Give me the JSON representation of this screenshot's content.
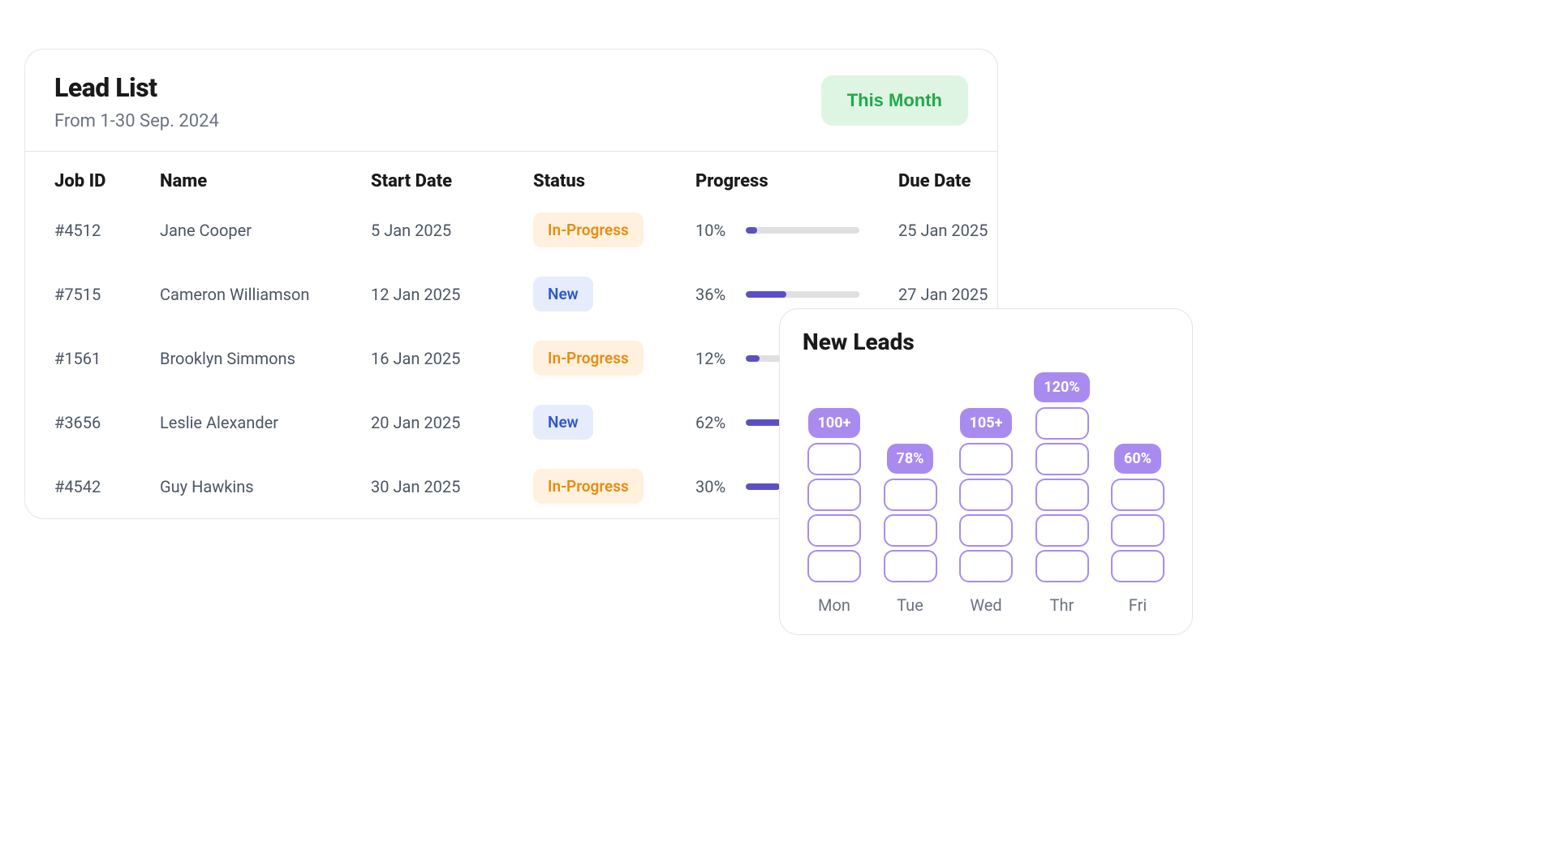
{
  "lead_list": {
    "title": "Lead List",
    "subtitle": "From 1-30 Sep. 2024",
    "period_label": "This Month",
    "columns": {
      "job_id": "Job ID",
      "name": "Name",
      "start_date": "Start Date",
      "status": "Status",
      "progress": "Progress",
      "due_date": "Due Date"
    },
    "rows": [
      {
        "job_id": "#4512",
        "name": "Jane Cooper",
        "start_date": "5 Jan 2025",
        "status": "In-Progress",
        "status_kind": "inprogress",
        "progress": 10,
        "progress_label": "10%",
        "due_date": "25 Jan 2025"
      },
      {
        "job_id": "#7515",
        "name": "Cameron Williamson",
        "start_date": "12 Jan 2025",
        "status": "New",
        "status_kind": "new",
        "progress": 36,
        "progress_label": "36%",
        "due_date": "27 Jan 2025"
      },
      {
        "job_id": "#1561",
        "name": "Brooklyn Simmons",
        "start_date": "16 Jan 2025",
        "status": "In-Progress",
        "status_kind": "inprogress",
        "progress": 12,
        "progress_label": "12%",
        "due_date": ""
      },
      {
        "job_id": "#3656",
        "name": "Leslie Alexander",
        "start_date": "20 Jan 2025",
        "status": "New",
        "status_kind": "new",
        "progress": 62,
        "progress_label": "62%",
        "due_date": ""
      },
      {
        "job_id": "#4542",
        "name": "Guy Hawkins",
        "start_date": "30 Jan 2025",
        "status": "In-Progress",
        "status_kind": "inprogress",
        "progress": 30,
        "progress_label": "30%",
        "due_date": ""
      }
    ]
  },
  "new_leads": {
    "title": "New Leads",
    "days": [
      {
        "label": "Mon",
        "value_label": "100+",
        "blocks": 4
      },
      {
        "label": "Tue",
        "value_label": "78%",
        "blocks": 3
      },
      {
        "label": "Wed",
        "value_label": "105+",
        "blocks": 4
      },
      {
        "label": "Thr",
        "value_label": "120%",
        "blocks": 5
      },
      {
        "label": "Fri",
        "value_label": "60%",
        "blocks": 3
      }
    ]
  },
  "chart_data": {
    "type": "bar",
    "title": "New Leads",
    "categories": [
      "Mon",
      "Tue",
      "Wed",
      "Thr",
      "Fri"
    ],
    "values": [
      4,
      3,
      4,
      5,
      3
    ],
    "data_labels": [
      "100+",
      "78%",
      "105+",
      "120%",
      "60%"
    ],
    "xlabel": "",
    "ylabel": "",
    "ylim": [
      0,
      5
    ]
  },
  "colors": {
    "accent_purple": "#a98bf0",
    "progress_fill": "#5b4fc9",
    "status_inprogress_bg": "#fff1de",
    "status_inprogress_fg": "#e88b12",
    "status_new_bg": "#e6ecfb",
    "status_new_fg": "#2b57d6",
    "period_bg": "#dff5e3",
    "period_fg": "#22a94a"
  }
}
